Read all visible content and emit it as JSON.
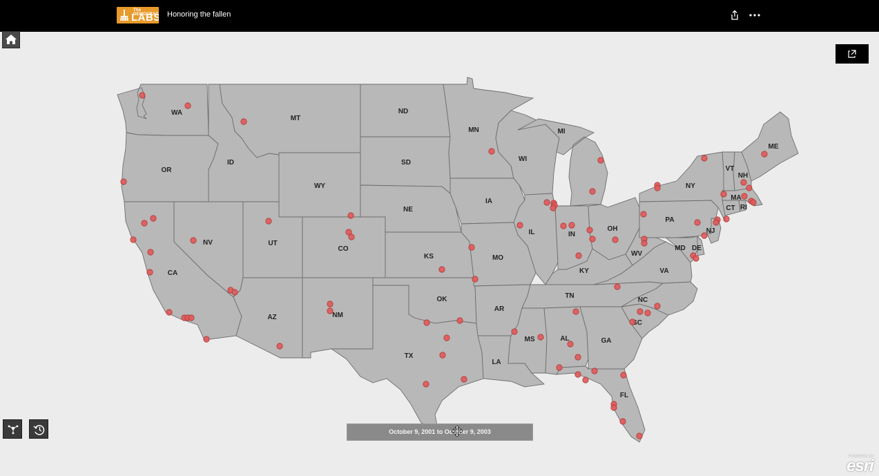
{
  "header": {
    "logo_line1": "The DEMOCRACY",
    "logo_line2": "LABS",
    "title": "Honoring the fallen"
  },
  "map": {
    "state_labels": [
      {
        "abbr": "WA"
      },
      {
        "abbr": "OR"
      },
      {
        "abbr": "CA"
      },
      {
        "abbr": "ID"
      },
      {
        "abbr": "NV"
      },
      {
        "abbr": "MT"
      },
      {
        "abbr": "WY"
      },
      {
        "abbr": "UT"
      },
      {
        "abbr": "AZ"
      },
      {
        "abbr": "CO"
      },
      {
        "abbr": "NM"
      },
      {
        "abbr": "ND"
      },
      {
        "abbr": "SD"
      },
      {
        "abbr": "NE"
      },
      {
        "abbr": "KS"
      },
      {
        "abbr": "OK"
      },
      {
        "abbr": "TX"
      },
      {
        "abbr": "MN"
      },
      {
        "abbr": "IA"
      },
      {
        "abbr": "MO"
      },
      {
        "abbr": "AR"
      },
      {
        "abbr": "LA"
      },
      {
        "abbr": "WI"
      },
      {
        "abbr": "IL"
      },
      {
        "abbr": "MI"
      },
      {
        "abbr": "IN"
      },
      {
        "abbr": "OH"
      },
      {
        "abbr": "KY"
      },
      {
        "abbr": "TN"
      },
      {
        "abbr": "MS"
      },
      {
        "abbr": "AL"
      },
      {
        "abbr": "GA"
      },
      {
        "abbr": "FL"
      },
      {
        "abbr": "SC"
      },
      {
        "abbr": "NC"
      },
      {
        "abbr": "VA"
      },
      {
        "abbr": "WV"
      },
      {
        "abbr": "PA"
      },
      {
        "abbr": "NY"
      },
      {
        "abbr": "MD"
      },
      {
        "abbr": "DE"
      },
      {
        "abbr": "NJ"
      },
      {
        "abbr": "CT"
      },
      {
        "abbr": "RI"
      },
      {
        "abbr": "MA"
      },
      {
        "abbr": "VT"
      },
      {
        "abbr": "NH"
      },
      {
        "abbr": "ME"
      }
    ],
    "marker_color": "#e05a5a",
    "state_fill": "#b8b8b8",
    "background": "#ececec"
  },
  "time_slider": {
    "label": "October 9, 2001 to October 9, 2003"
  },
  "attribution": {
    "powered_by": "POWERED BY",
    "brand": "esri"
  }
}
